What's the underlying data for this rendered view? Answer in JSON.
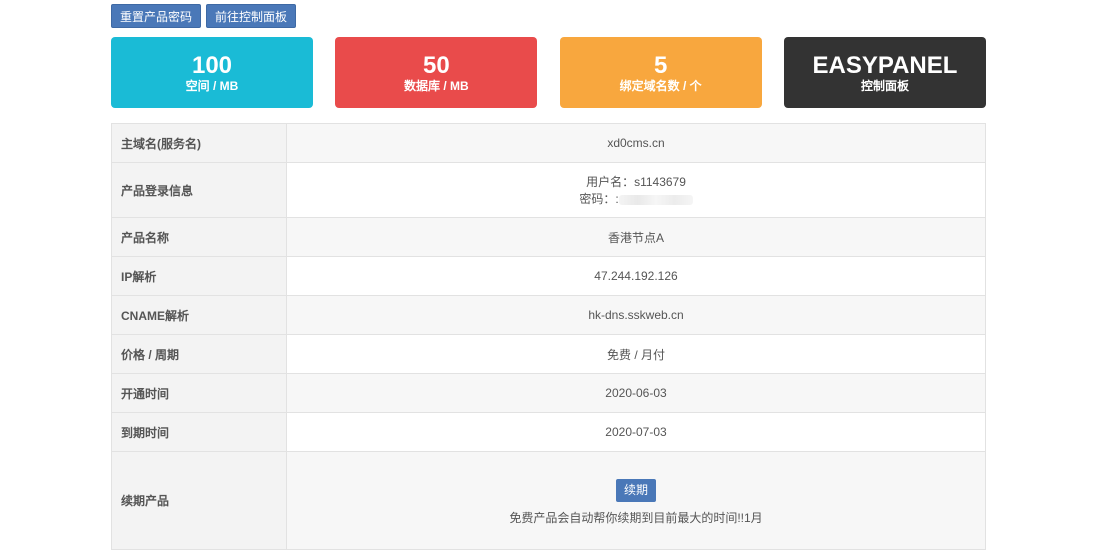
{
  "toolbar": {
    "reset_password": "重置产品密码",
    "goto_panel": "前往控制面板"
  },
  "cards": [
    {
      "value": "100",
      "label": "空间 / MB",
      "color": "#1abbd6"
    },
    {
      "value": "50",
      "label": "数据库 / MB",
      "color": "#e94b4b"
    },
    {
      "value": "5",
      "label": "绑定域名数 / 个",
      "color": "#f8a73e"
    },
    {
      "value": "EASYPANEL",
      "label": "控制面板",
      "color": "#333333"
    }
  ],
  "info": {
    "main_domain": {
      "label": "主域名(服务名)",
      "value": "xd0cms.cn"
    },
    "login": {
      "label": "产品登录信息",
      "username_line": "用户名：s1143679",
      "password_prefix": "密码：:"
    },
    "product_name": {
      "label": "产品名称",
      "value": "香港节点A"
    },
    "ip": {
      "label": "IP解析",
      "value": "47.244.192.126"
    },
    "cname": {
      "label": "CNAME解析",
      "value": "hk-dns.sskweb.cn"
    },
    "price": {
      "label": "价格 / 周期",
      "value": "免费 / 月付"
    },
    "open_time": {
      "label": "开通时间",
      "value": "2020-06-03"
    },
    "expire_time": {
      "label": "到期时间",
      "value": "2020-07-03"
    },
    "renew": {
      "label": "续期产品",
      "button": "续期",
      "note": "免费产品会自动帮你续期到目前最大的时间!!1月"
    }
  }
}
